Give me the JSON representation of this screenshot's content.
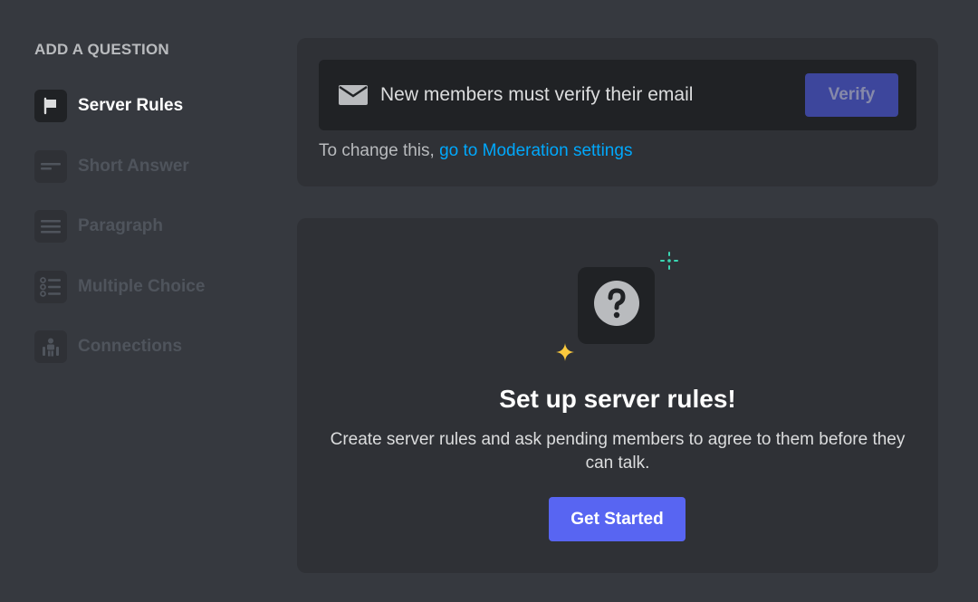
{
  "sidebar": {
    "heading": "ADD A QUESTION",
    "items": [
      {
        "label": "Server Rules",
        "icon": "flag-icon",
        "active": true
      },
      {
        "label": "Short Answer",
        "icon": "short-answer-icon",
        "active": false
      },
      {
        "label": "Paragraph",
        "icon": "paragraph-icon",
        "active": false
      },
      {
        "label": "Multiple Choice",
        "icon": "multiple-choice-icon",
        "active": false
      },
      {
        "label": "Connections",
        "icon": "connections-icon",
        "active": false
      }
    ]
  },
  "verification": {
    "message": "New members must verify their email",
    "button_label": "Verify",
    "change_prefix": "To change this,",
    "change_link": "go to Moderation settings"
  },
  "empty_state": {
    "icon": "question-mark-icon",
    "title": "Set up server rules!",
    "description": "Create server rules and ask pending members to agree to them before they can talk.",
    "button_label": "Get Started"
  },
  "colors": {
    "background": "#36393f",
    "card": "#2f3136",
    "dark": "#202225",
    "brand": "#5865f2",
    "link": "#00a8fc",
    "sparkle_teal": "#3ad6b3",
    "sparkle_yellow": "#fbc93d"
  }
}
